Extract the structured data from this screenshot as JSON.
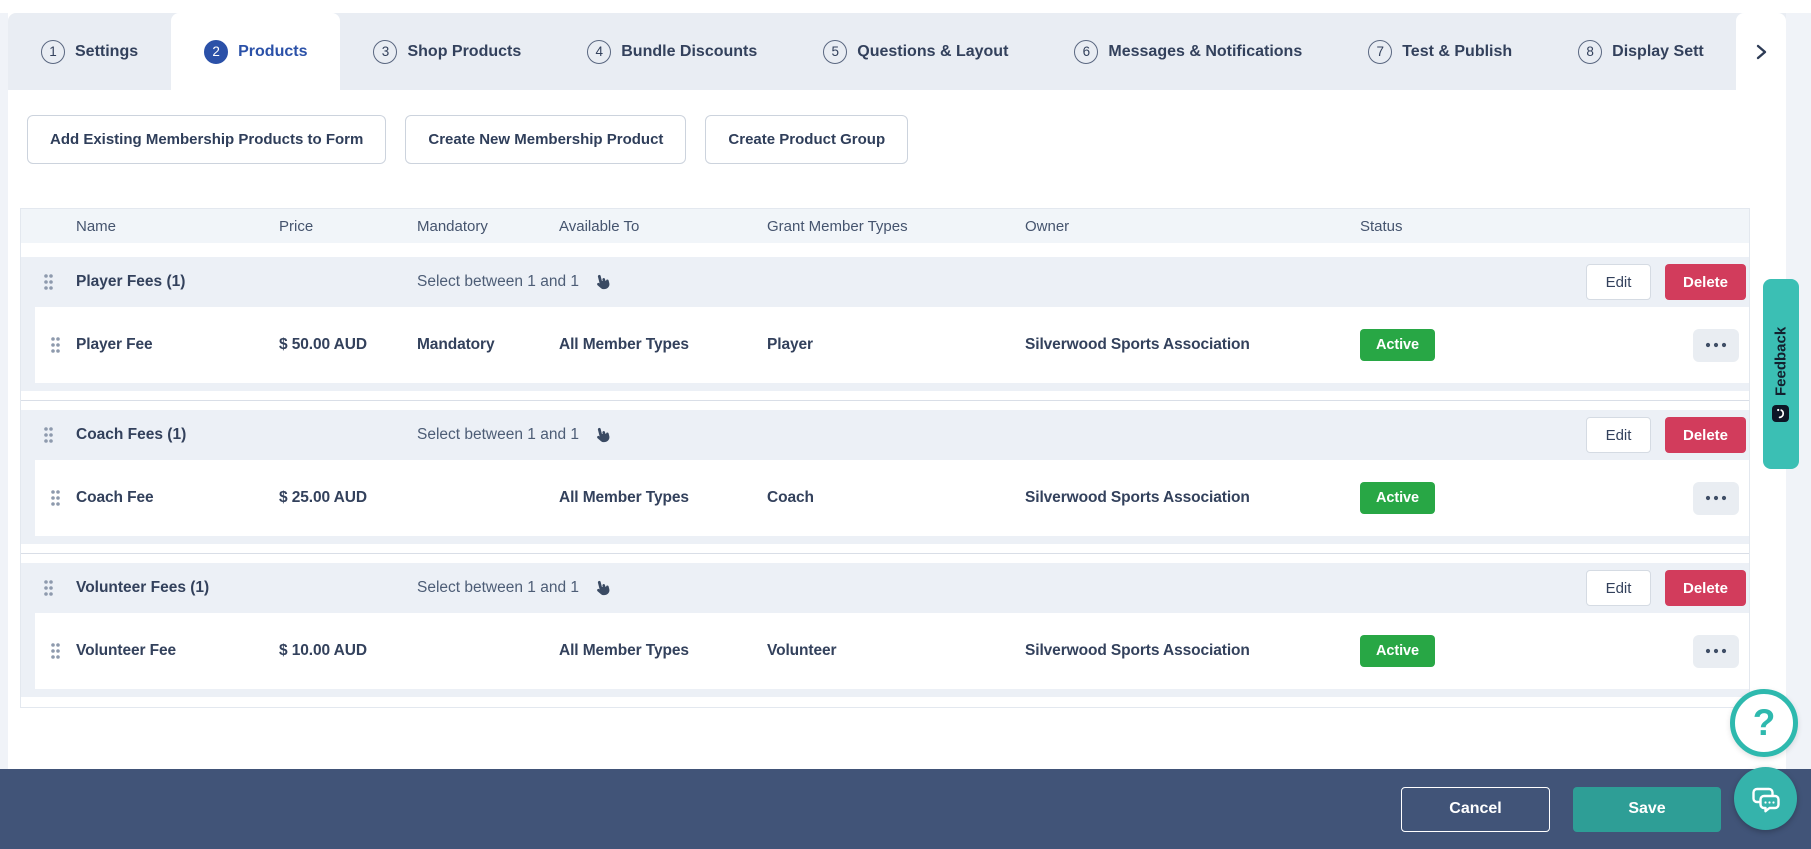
{
  "tabs": [
    {
      "num": "1",
      "label": "Settings",
      "active": false
    },
    {
      "num": "2",
      "label": "Products",
      "active": true
    },
    {
      "num": "3",
      "label": "Shop Products",
      "active": false
    },
    {
      "num": "4",
      "label": "Bundle Discounts",
      "active": false
    },
    {
      "num": "5",
      "label": "Questions & Layout",
      "active": false
    },
    {
      "num": "6",
      "label": "Messages & Notifications",
      "active": false
    },
    {
      "num": "7",
      "label": "Test & Publish",
      "active": false
    },
    {
      "num": "8",
      "label": "Display Sett",
      "active": false
    }
  ],
  "toolbar": {
    "buttons": [
      "Add Existing Membership Products to Form",
      "Create New Membership Product",
      "Create Product Group"
    ]
  },
  "table": {
    "headers": [
      "Name",
      "Price",
      "Mandatory",
      "Available To",
      "Grant Member Types",
      "Owner",
      "Status"
    ],
    "actions": {
      "edit": "Edit",
      "delete": "Delete"
    },
    "groups": [
      {
        "name": "Player Fees (1)",
        "rule": "Select between 1 and 1",
        "products": [
          {
            "name": "Player Fee",
            "price": "$ 50.00 AUD",
            "mandatory": "Mandatory",
            "available_to": "All Member Types",
            "grant_member_types": "Player",
            "owner": "Silverwood Sports Association",
            "status": "Active"
          }
        ]
      },
      {
        "name": "Coach Fees (1)",
        "rule": "Select between 1 and 1",
        "products": [
          {
            "name": "Coach Fee",
            "price": "$ 25.00 AUD",
            "mandatory": "",
            "available_to": "All Member Types",
            "grant_member_types": "Coach",
            "owner": "Silverwood Sports Association",
            "status": "Active"
          }
        ]
      },
      {
        "name": "Volunteer Fees (1)",
        "rule": "Select between 1 and 1",
        "products": [
          {
            "name": "Volunteer Fee",
            "price": "$ 10.00 AUD",
            "mandatory": "",
            "available_to": "All Member Types",
            "grant_member_types": "Volunteer",
            "owner": "Silverwood Sports Association",
            "status": "Active"
          }
        ]
      }
    ]
  },
  "footer": {
    "cancel": "Cancel",
    "save": "Save"
  },
  "widgets": {
    "feedback_label": "Feedback",
    "help_glyph": "?"
  },
  "icons": {
    "tabs_overflow": "chevron-right",
    "group_drag": "drag-handle",
    "selection_rule": "pointer-hand",
    "row_menu": "ellipsis",
    "help": "question-mark",
    "chat": "chat-bubbles"
  },
  "colors": {
    "active_tab_blue": "#2b51a8",
    "badge_green": "#28a745",
    "delete_red": "#d23c5c",
    "footer_navy": "#415478",
    "save_teal": "#2e9e96",
    "widget_teal": "#3bbfb4"
  }
}
